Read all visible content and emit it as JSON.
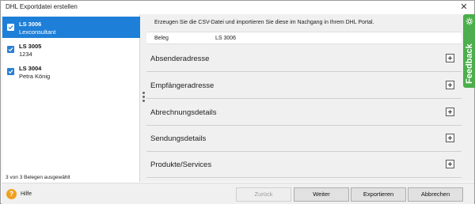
{
  "window": {
    "title": "DHL Exportdatei erstellen",
    "close_glyph": "✕"
  },
  "list": {
    "items": [
      {
        "title": "LS 3006",
        "subtitle": "Lexconsultant",
        "checked": true,
        "selected": true
      },
      {
        "title": "LS 3005",
        "subtitle": "1234",
        "checked": true,
        "selected": false
      },
      {
        "title": "LS 3004",
        "subtitle": "Petra König",
        "checked": true,
        "selected": false
      }
    ],
    "footer": "3 von 3 Belegen ausgewählt"
  },
  "main": {
    "info": "Erzeugen Sie die CSV-Datei und importieren Sie diese im Nachgang in Ihrem DHL Portal.",
    "beleg_label": "Beleg",
    "beleg_value": "LS 3006",
    "sections": [
      {
        "label": "Absenderadresse"
      },
      {
        "label": "Empfängeradresse"
      },
      {
        "label": "Abrechnungsdetails"
      },
      {
        "label": "Sendungsdetails"
      },
      {
        "label": "Produkte/Services"
      }
    ]
  },
  "feedback": {
    "label": "Feedback",
    "color": "#4cae4c"
  },
  "footer": {
    "help_label": "Hilfe",
    "help_glyph": "?",
    "buttons": {
      "back": "Zurück",
      "next": "Weiter",
      "export": "Exportieren",
      "cancel": "Abbrechen"
    }
  },
  "colors": {
    "selection": "#1e7fd8",
    "checkbox": "#2a7fd4",
    "help": "#f0a020"
  }
}
